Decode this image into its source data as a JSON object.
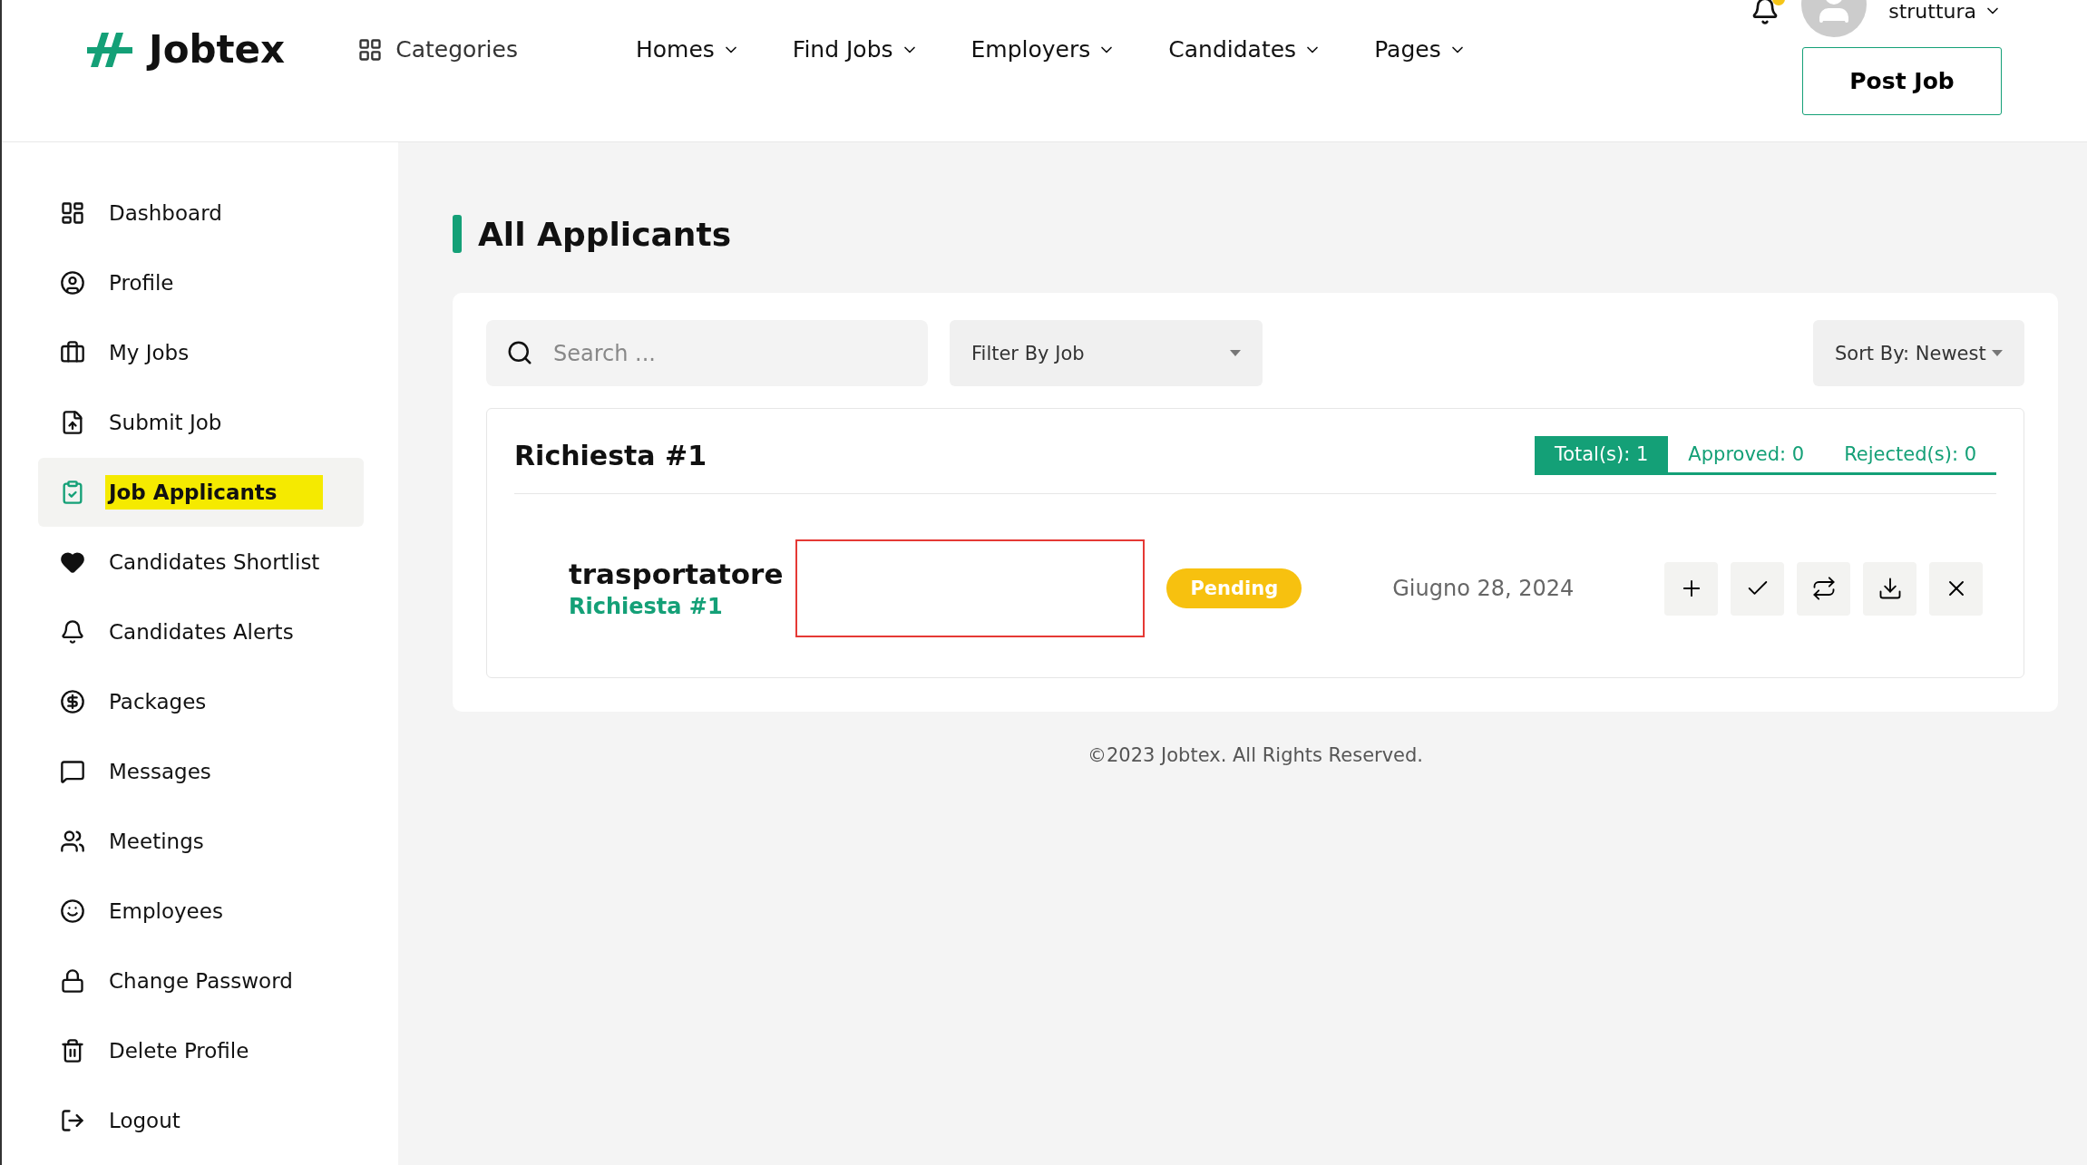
{
  "header": {
    "logo": "Jobtex",
    "categories": "Categories",
    "nav": [
      {
        "label": "Homes"
      },
      {
        "label": "Find Jobs"
      },
      {
        "label": "Employers"
      },
      {
        "label": "Candidates"
      },
      {
        "label": "Pages"
      }
    ],
    "user": "struttura",
    "post_job": "Post Job"
  },
  "sidebar": {
    "items": [
      {
        "label": "Dashboard",
        "selected": false
      },
      {
        "label": "Profile",
        "selected": false
      },
      {
        "label": "My Jobs",
        "selected": false
      },
      {
        "label": "Submit Job",
        "selected": false
      },
      {
        "label": "Job Applicants",
        "selected": true
      },
      {
        "label": "Candidates Shortlist",
        "selected": false
      },
      {
        "label": "Candidates Alerts",
        "selected": false
      },
      {
        "label": "Packages",
        "selected": false
      },
      {
        "label": "Messages",
        "selected": false
      },
      {
        "label": "Meetings",
        "selected": false
      },
      {
        "label": "Employees",
        "selected": false
      },
      {
        "label": "Change Password",
        "selected": false
      },
      {
        "label": "Delete Profile",
        "selected": false
      },
      {
        "label": "Logout",
        "selected": false
      }
    ]
  },
  "page_title": "All Applicants",
  "search": {
    "placeholder": "Search ..."
  },
  "filter": {
    "value": "Filter By Job"
  },
  "sort": {
    "value": "Sort By: Newest"
  },
  "group": {
    "title": "Richiesta #1",
    "tabs": [
      {
        "label": "Total(s): 1",
        "selected": true
      },
      {
        "label": "Approved: 0",
        "selected": false
      },
      {
        "label": "Rejected(s): 0",
        "selected": false
      }
    ],
    "applicants": [
      {
        "name": "trasportatore",
        "job": "Richiesta #1",
        "status": "Pending",
        "date": "Giugno 28, 2024"
      }
    ]
  },
  "footer": "©2023 Jobtex. All Rights Reserved."
}
